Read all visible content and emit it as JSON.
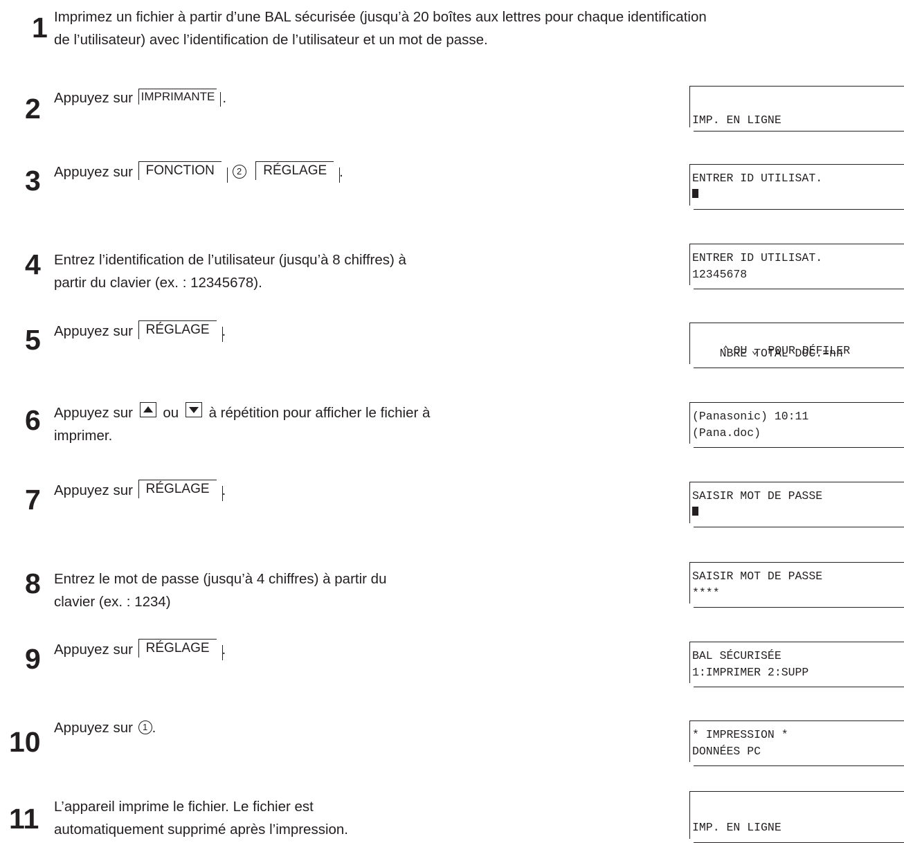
{
  "steps": [
    {
      "num": "1",
      "line1": "Imprimez un fichier à partir d’une BAL sécurisée (jusqu’à 20 boîtes aux lettres pour chaque identification",
      "line2": "de l’utilisateur) avec l’identification de l’utilisateur et un mot de passe."
    },
    {
      "num": "2",
      "prefix": "Appuyez sur",
      "key": "IMPRIMANTE",
      "suffix": "."
    },
    {
      "num": "3",
      "prefix": "Appuyez sur",
      "key1": "FONCTION",
      "circle": "2",
      "key2": "RÉGLAGE",
      "suffix": "."
    },
    {
      "num": "4",
      "line1": "Entrez l’identification de l’utilisateur (jusqu’à 8 chiffres) à",
      "line2": "partir du clavier (ex. : 12345678)."
    },
    {
      "num": "5",
      "prefix": "Appuyez sur",
      "key": "RÉGLAGE",
      "suffix": "."
    },
    {
      "num": "6",
      "prefix": "Appuyez sur",
      "middle": "ou",
      "rest": "à répétition pour afficher le fichier à",
      "line2": "imprimer."
    },
    {
      "num": "7",
      "prefix": "Appuyez sur",
      "key": "RÉGLAGE",
      "suffix": "."
    },
    {
      "num": "8",
      "line1": "Entrez le mot de passe (jusqu’à 4 chiffres) à partir du",
      "line2": "clavier (ex. : 1234)"
    },
    {
      "num": "9",
      "prefix": "Appuyez sur",
      "key": "RÉGLAGE",
      "suffix": "."
    },
    {
      "num": "10",
      "prefix": "Appuyez sur",
      "circle": "1",
      "suffix": "."
    },
    {
      "num": "11",
      "line1": "L’appareil imprime le fichier. Le fichier est",
      "line2": "automatiquement supprimé après l’impression."
    }
  ],
  "displays": [
    {
      "line1": "",
      "line2": "IMP. EN LIGNE"
    },
    {
      "line1": "ENTRER ID UTILISAT.",
      "line2": ""
    },
    {
      "line1": "ENTRER ID UTILISAT.",
      "line2": "12345678"
    },
    {
      "line1_a": "OU",
      "line1_b": "POUR DÉFILER",
      "line2": "    NBRE TOTAL DOC.=nn"
    },
    {
      "line1": "(Panasonic) 10:11",
      "line2": "(Pana.doc)"
    },
    {
      "line1": "SAISIR MOT DE PASSE",
      "line2": ""
    },
    {
      "line1": "SAISIR MOT DE PASSE",
      "line2": "****"
    },
    {
      "line1": "BAL SÉCURISÉE",
      "line2": "1:IMPRIMER 2:SUPP"
    },
    {
      "line1": "* IMPRESSION *",
      "line2": "DONNÉES PC"
    },
    {
      "line1": "",
      "line2": "IMP. EN LIGNE"
    }
  ]
}
